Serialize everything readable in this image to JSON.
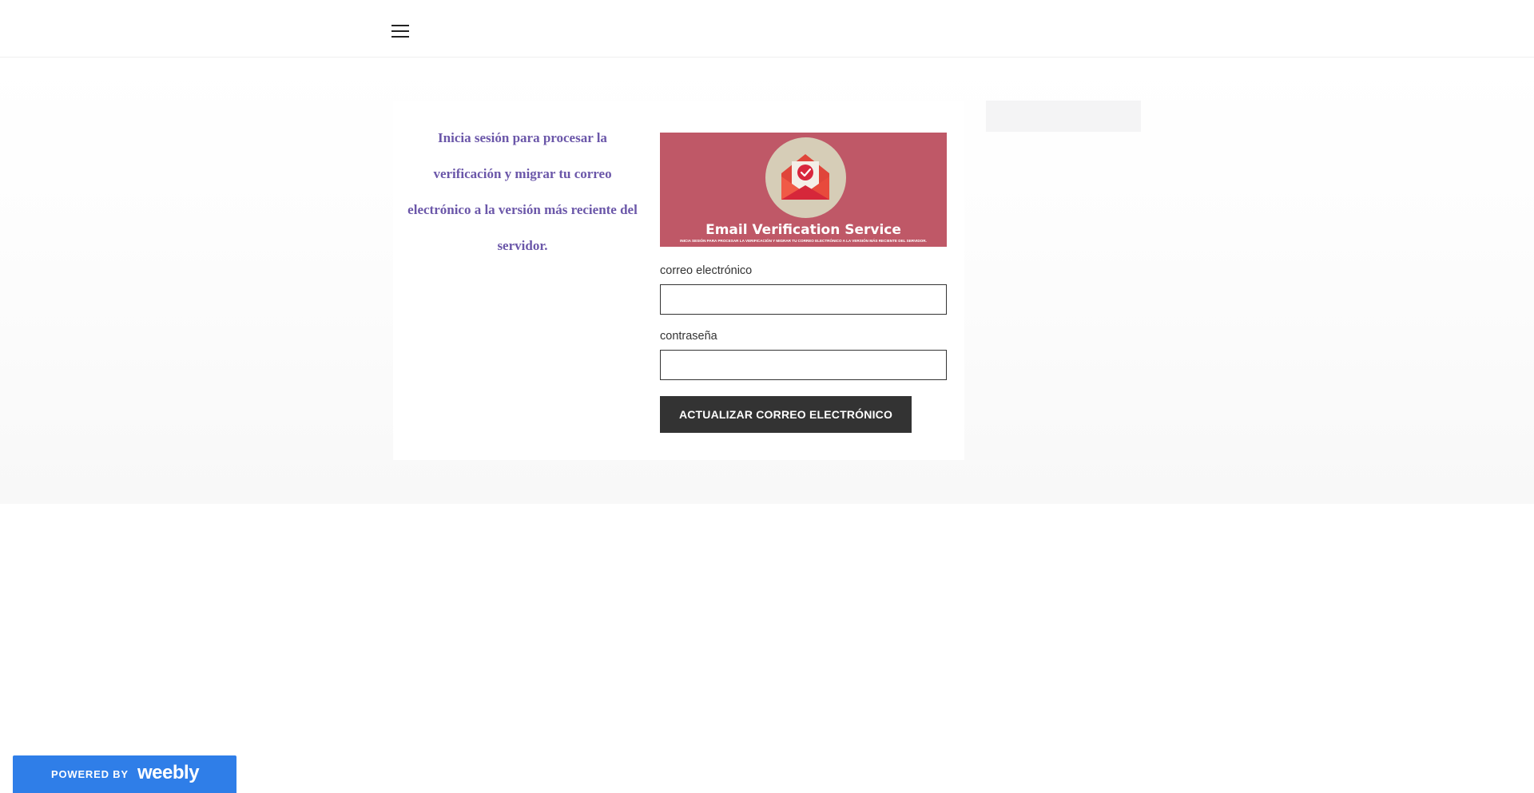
{
  "header": {
    "menu_icon": "hamburger-menu-icon"
  },
  "intro": {
    "text": "Inicia sesión para procesar la verificación y migrar tu correo electrónico a la versión más reciente del servidor."
  },
  "banner": {
    "icon": "envelope-check-icon",
    "title": "Email Verification Service",
    "subtitle": "INICIA SESIÓN PARA PROCESAR LA VERIFICACIÓN Y MIGRAR TU CORREO ELECTRÓNICO A LA VERSIÓN MÁS RECIENTE DEL SERVIDOR.",
    "background_color": "#bf5867"
  },
  "form": {
    "email_label": "correo electrónico",
    "email_value": "",
    "password_label": "contraseña",
    "password_value": "",
    "submit_label": "ACTUALIZAR CORREO ELECTRÓNICO"
  },
  "badge": {
    "powered_by": "POWERED BY",
    "brand": "weebly",
    "color": "#2f7ee8"
  },
  "colors": {
    "intro_text": "#6b57a9",
    "button": "#333333"
  }
}
